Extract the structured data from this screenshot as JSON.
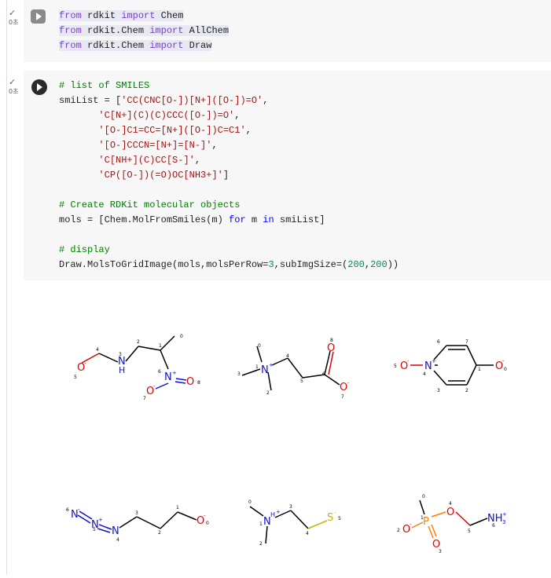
{
  "cells": [
    {
      "status": {
        "check": "✓",
        "time": "0초"
      },
      "code_lines": [
        [
          {
            "t": "from",
            "c": "kw"
          },
          {
            "t": " rdkit ",
            "c": ""
          },
          {
            "t": "import",
            "c": "kw"
          },
          {
            "t": " Chem",
            "c": ""
          }
        ],
        [
          {
            "t": "from",
            "c": "kw"
          },
          {
            "t": " rdkit.Chem ",
            "c": ""
          },
          {
            "t": "import",
            "c": "kw"
          },
          {
            "t": " AllChem",
            "c": ""
          }
        ],
        [
          {
            "t": "from",
            "c": "kw"
          },
          {
            "t": " rdkit.Chem ",
            "c": ""
          },
          {
            "t": "import",
            "c": "kw"
          },
          {
            "t": " Draw",
            "c": ""
          }
        ]
      ]
    },
    {
      "status": {
        "check": "✓",
        "time": "0초"
      },
      "code_lines": [
        [
          {
            "t": "# list of SMILES",
            "c": "cm"
          }
        ],
        [
          {
            "t": "smiList = [",
            "c": ""
          },
          {
            "t": "'CC(CNC[O-])[N+]([O-])=O'",
            "c": "str"
          },
          {
            "t": ",",
            "c": ""
          }
        ],
        [
          {
            "t": "       ",
            "c": ""
          },
          {
            "t": "'C[N+](C)(C)CCC([O-])=O'",
            "c": "str"
          },
          {
            "t": ",",
            "c": ""
          }
        ],
        [
          {
            "t": "       ",
            "c": ""
          },
          {
            "t": "'[O-]C1=CC=[N+]([O-])C=C1'",
            "c": "str"
          },
          {
            "t": ",",
            "c": ""
          }
        ],
        [
          {
            "t": "       ",
            "c": ""
          },
          {
            "t": "'[O-]CCCN=[N+]=[N-]'",
            "c": "str"
          },
          {
            "t": ",",
            "c": ""
          }
        ],
        [
          {
            "t": "       ",
            "c": ""
          },
          {
            "t": "'C[NH+](C)CC[S-]'",
            "c": "str"
          },
          {
            "t": ",",
            "c": ""
          }
        ],
        [
          {
            "t": "       ",
            "c": ""
          },
          {
            "t": "'CP([O-])(=O)OC[NH3+]'",
            "c": "str"
          },
          {
            "t": "]",
            "c": ""
          }
        ],
        [
          {
            "t": "",
            "c": ""
          }
        ],
        [
          {
            "t": "# Create RDKit molecular objects",
            "c": "cm"
          }
        ],
        [
          {
            "t": "mols = [Chem.MolFromSmiles(m) ",
            "c": ""
          },
          {
            "t": "for",
            "c": "kw2"
          },
          {
            "t": " m ",
            "c": ""
          },
          {
            "t": "in",
            "c": "kw2"
          },
          {
            "t": " smiList]",
            "c": ""
          }
        ],
        [
          {
            "t": "",
            "c": ""
          }
        ],
        [
          {
            "t": "# display",
            "c": "cm"
          }
        ],
        [
          {
            "t": "Draw.MolsToGridImage(mols,molsPerRow=",
            "c": ""
          },
          {
            "t": "3",
            "c": "num"
          },
          {
            "t": ",subImgSize=(",
            "c": ""
          },
          {
            "t": "200",
            "c": "num"
          },
          {
            "t": ",",
            "c": ""
          },
          {
            "t": "200",
            "c": "num"
          },
          {
            "t": "))",
            "c": ""
          }
        ]
      ]
    }
  ],
  "molecules": [
    {
      "smiles": "CC(CNC[O-])[N+]([O-])=O",
      "atoms": [
        {
          "label": "O",
          "charge": "-",
          "idx": "5",
          "color": "#e00000"
        },
        {
          "label": "N",
          "sub": "H",
          "idx": "3",
          "color": "#1010d0"
        },
        {
          "label": "N",
          "charge": "+",
          "idx": "6",
          "color": "#1010d0"
        },
        {
          "label": "O",
          "idx": "8",
          "color": "#e00000"
        },
        {
          "label": "O",
          "charge": "-",
          "idx": "7",
          "color": "#e00000"
        }
      ],
      "carbon_indices": [
        "4",
        "2",
        "1",
        "0"
      ]
    },
    {
      "smiles": "C[N+](C)(C)CCC([O-])=O",
      "atoms": [
        {
          "label": "N",
          "charge": "+",
          "idx": "1",
          "color": "#1010d0"
        },
        {
          "label": "O",
          "idx": "8",
          "color": "#e00000"
        },
        {
          "label": "O",
          "charge": "-",
          "idx": "7",
          "color": "#e00000"
        }
      ],
      "carbon_indices": [
        "0",
        "3",
        "2",
        "4",
        "5",
        "6"
      ]
    },
    {
      "smiles": "[O-]C1=CC=[N+]([O-])C=C1",
      "atoms": [
        {
          "label": "O",
          "charge": "-",
          "idx": "5",
          "color": "#e00000"
        },
        {
          "label": "N",
          "charge": "+",
          "idx": "4",
          "color": "#1010d0"
        },
        {
          "label": "O",
          "charge": "-",
          "idx": "0",
          "color": "#e00000"
        }
      ],
      "carbon_indices": [
        "6",
        "7",
        "1",
        "2",
        "3"
      ]
    },
    {
      "smiles": "[O-]CCCN=[N+]=[N-]",
      "atoms": [
        {
          "label": "N",
          "charge": "-",
          "idx": "6",
          "color": "#1010d0"
        },
        {
          "label": "N",
          "charge": "+",
          "idx": "5",
          "color": "#1010d0"
        },
        {
          "label": "N",
          "idx": "4",
          "color": "#1010d0"
        },
        {
          "label": "O",
          "charge": "-",
          "idx": "0",
          "color": "#e00000"
        }
      ],
      "carbon_indices": [
        "3",
        "2",
        "1"
      ]
    },
    {
      "smiles": "C[NH+](C)CC[S-]",
      "atoms": [
        {
          "label": "N",
          "sub": "H",
          "charge": "+",
          "idx": "1",
          "color": "#1010d0"
        },
        {
          "label": "S",
          "charge": "-",
          "idx": "5",
          "color": "#c8b400"
        }
      ],
      "carbon_indices": [
        "0",
        "2",
        "3",
        "4"
      ]
    },
    {
      "smiles": "CP([O-])(=O)OC[NH3+]",
      "atoms": [
        {
          "label": "P",
          "idx": "1",
          "color": "#ff8000"
        },
        {
          "label": "O",
          "charge": "-",
          "idx": "2",
          "color": "#e00000"
        },
        {
          "label": "O",
          "idx": "3",
          "color": "#e00000"
        },
        {
          "label": "O",
          "idx": "4",
          "color": "#e00000"
        },
        {
          "label": "NH",
          "sub": "3",
          "charge": "+",
          "idx": "6",
          "color": "#1010d0"
        }
      ],
      "carbon_indices": [
        "0",
        "5"
      ]
    }
  ]
}
